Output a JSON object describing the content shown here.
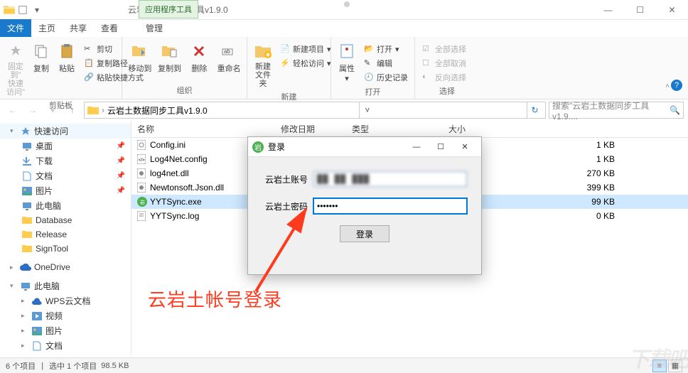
{
  "titlebar": {
    "tool_tab": "应用程序工具",
    "window_title": "云岩土数据同步工具v1.9.0"
  },
  "tabs": {
    "file": "文件",
    "home": "主页",
    "share": "共享",
    "view": "查看",
    "manage": "管理"
  },
  "ribbon": {
    "pin_label": "固定到\"\n快速访问\"",
    "copy": "复制",
    "paste": "粘贴",
    "cut": "剪切",
    "copy_path": "复制路径",
    "paste_shortcut": "粘贴快捷方式",
    "clipboard_group": "剪贴板",
    "move_to": "移动到",
    "copy_to": "复制到",
    "delete": "删除",
    "rename": "重命名",
    "organize_group": "组织",
    "new_folder": "新建\n文件夹",
    "new_item": "新建项目",
    "easy_access": "轻松访问",
    "new_group": "新建",
    "properties": "属性",
    "open": "打开",
    "edit": "编辑",
    "history": "历史记录",
    "open_group": "打开",
    "select_all": "全部选择",
    "select_none": "全部取消",
    "invert_selection": "反向选择",
    "select_group": "选择"
  },
  "breadcrumb": {
    "current": "云岩土数据同步工具v1.9.0",
    "search_placeholder": "搜索\"云岩土数据同步工具v1.9...."
  },
  "sidebar": {
    "quick_access": "快速访问",
    "items": [
      {
        "label": "桌面",
        "icon": "desktop",
        "pin": true
      },
      {
        "label": "下载",
        "icon": "download",
        "pin": true
      },
      {
        "label": "文档",
        "icon": "document",
        "pin": true
      },
      {
        "label": "图片",
        "icon": "picture",
        "pin": true
      },
      {
        "label": "此电脑",
        "icon": "pc",
        "pin": false
      },
      {
        "label": "Database",
        "icon": "folder",
        "pin": false
      },
      {
        "label": "Release",
        "icon": "folder",
        "pin": false
      },
      {
        "label": "SignTool",
        "icon": "folder",
        "pin": false
      }
    ],
    "onedrive": "OneDrive",
    "this_pc": "此电脑",
    "pc_items": [
      {
        "label": "WPS云文档",
        "icon": "wps"
      },
      {
        "label": "视频",
        "icon": "video"
      },
      {
        "label": "图片",
        "icon": "picture"
      },
      {
        "label": "文档",
        "icon": "document"
      }
    ]
  },
  "columns": {
    "name": "名称",
    "date": "修改日期",
    "type": "类型",
    "size": "大小"
  },
  "files": [
    {
      "name": "Config.ini",
      "icon": "ini",
      "size": "1 KB"
    },
    {
      "name": "Log4Net.config",
      "icon": "config",
      "size": "1 KB"
    },
    {
      "name": "log4net.dll",
      "icon": "dll",
      "size": "270 KB"
    },
    {
      "name": "Newtonsoft.Json.dll",
      "icon": "dll",
      "size": "399 KB"
    },
    {
      "name": "YYTSync.exe",
      "icon": "exe",
      "size": "99 KB",
      "selected": true
    },
    {
      "name": "YYTSync.log",
      "icon": "log",
      "size": "0 KB"
    }
  ],
  "statusbar": {
    "count": "6 个项目",
    "selection": "选中 1 个项目",
    "size": "98.5 KB"
  },
  "dialog": {
    "title": "登录",
    "account_label": "云岩土账号",
    "password_label": "云岩土密码",
    "password_value": "•••••••",
    "login_btn": "登录"
  },
  "annotation": "云岩土帐号登录",
  "watermark": "下载吧"
}
